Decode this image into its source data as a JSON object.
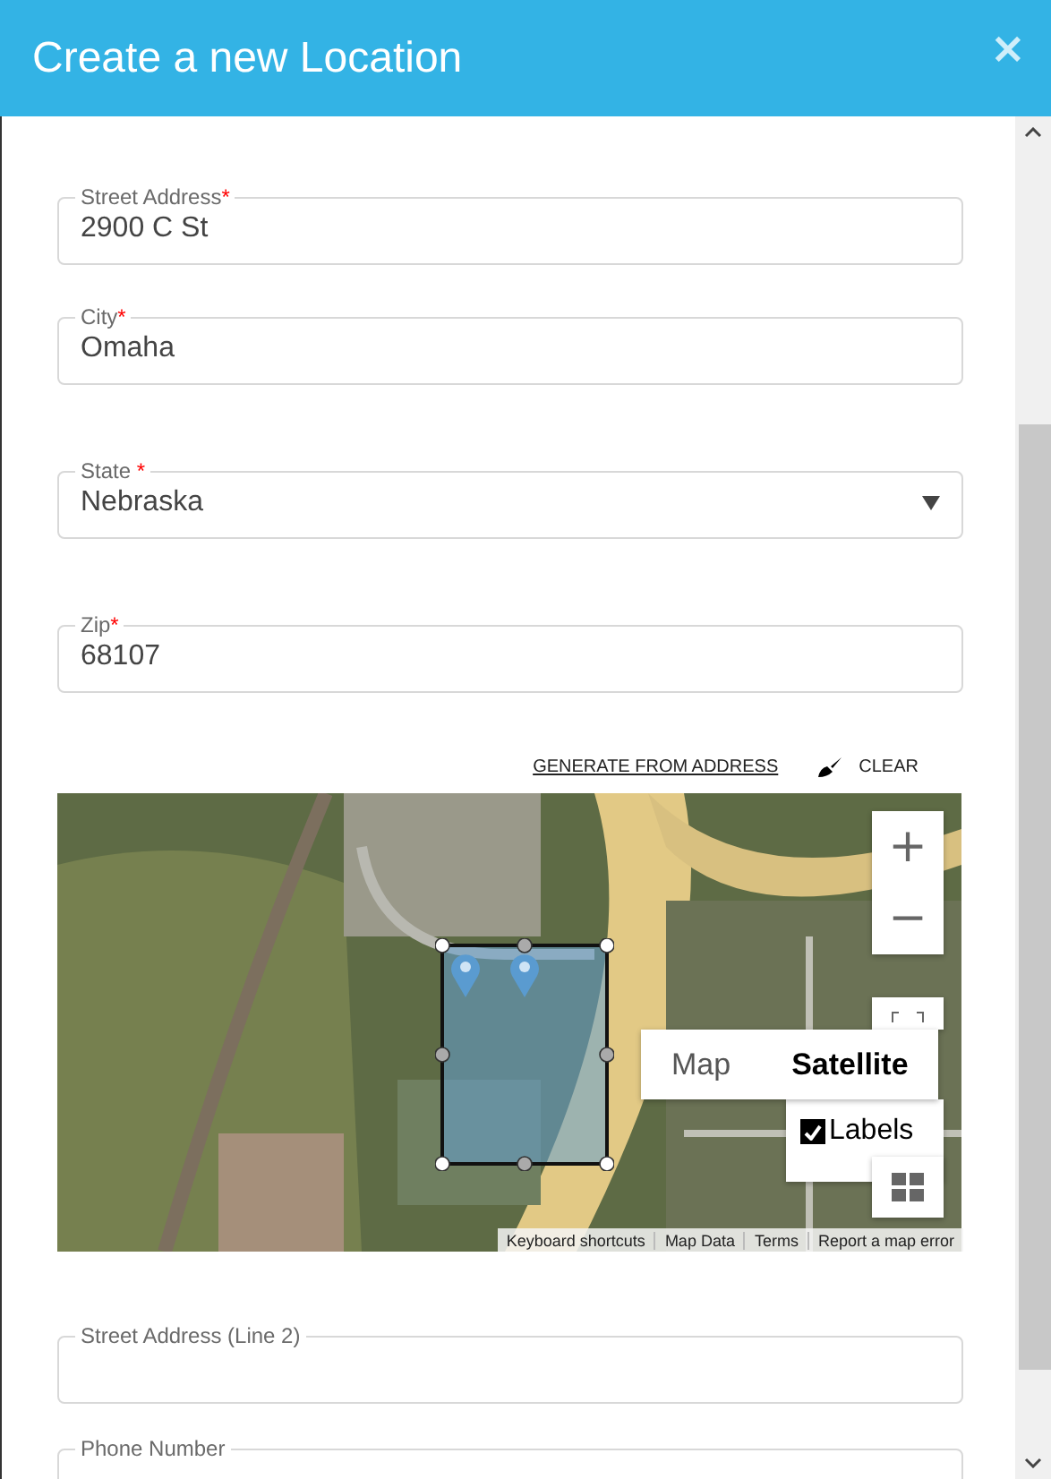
{
  "dialog": {
    "title": "Create a new Location",
    "close": "×"
  },
  "fields_top": [
    {
      "label": "Street Address",
      "required_mark": "*",
      "value": "2900 C St",
      "kind": "text"
    },
    {
      "label": "City",
      "required_mark": "*",
      "value": "Omaha",
      "kind": "text"
    },
    {
      "label": "State",
      "required_mark": " *",
      "value": "Nebraska",
      "kind": "select"
    },
    {
      "label": "Zip",
      "required_mark": "*",
      "value": "68107",
      "kind": "text"
    }
  ],
  "map_tools": {
    "generate": "GENERATE FROM ADDRESS",
    "clear": "CLEAR"
  },
  "map": {
    "kind": "picture",
    "zoom_in": "+",
    "zoom_out": "−",
    "map_types": [
      {
        "label": "Map",
        "selected": false
      },
      {
        "label": "Satellite",
        "selected": true
      }
    ],
    "labels": {
      "label": "Labels",
      "checked": true
    },
    "attribution": [
      "Keyboard shortcuts",
      "Map Data",
      "Terms",
      "Report a map error"
    ]
  },
  "fields_bottom": [
    {
      "label": "Street Address (Line 2)",
      "kind": "text"
    },
    {
      "label": "Phone Number",
      "kind": "text"
    }
  ]
}
